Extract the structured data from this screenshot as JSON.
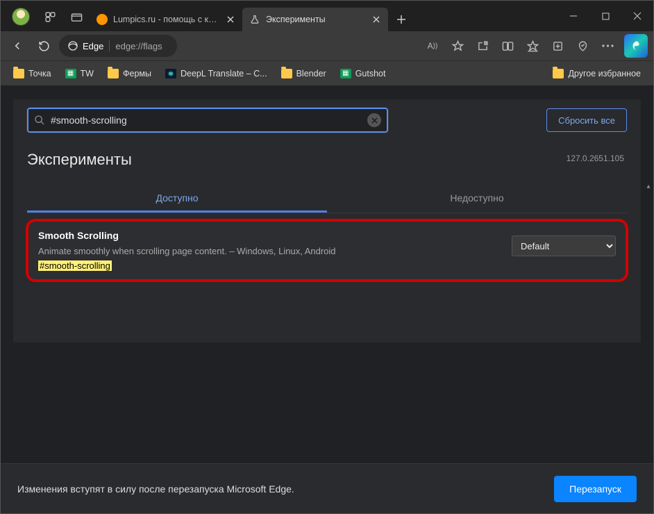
{
  "tabs": [
    {
      "title": "Lumpics.ru - помощь с компьют"
    },
    {
      "title": "Эксперименты"
    }
  ],
  "address": {
    "label": "Edge",
    "path": "edge://flags"
  },
  "bookmarks": {
    "items": [
      "Точка",
      "TW",
      "Фермы",
      "DeepL Translate – C...",
      "Blender",
      "Gutshot"
    ],
    "other": "Другое избранное"
  },
  "flags": {
    "search_value": "#smooth-scrolling",
    "reset": "Сбросить все",
    "title": "Эксперименты",
    "version": "127.0.2651.105",
    "tab_available": "Доступно",
    "tab_unavailable": "Недоступно",
    "entry": {
      "title": "Smooth Scrolling",
      "desc": "Animate smoothly when scrolling page content. – Windows, Linux, Android",
      "hash": "#smooth-scrolling",
      "selected": "Default"
    }
  },
  "restart": {
    "msg": "Изменения вступят в силу после перезапуска Microsoft Edge.",
    "btn": "Перезапуск"
  }
}
